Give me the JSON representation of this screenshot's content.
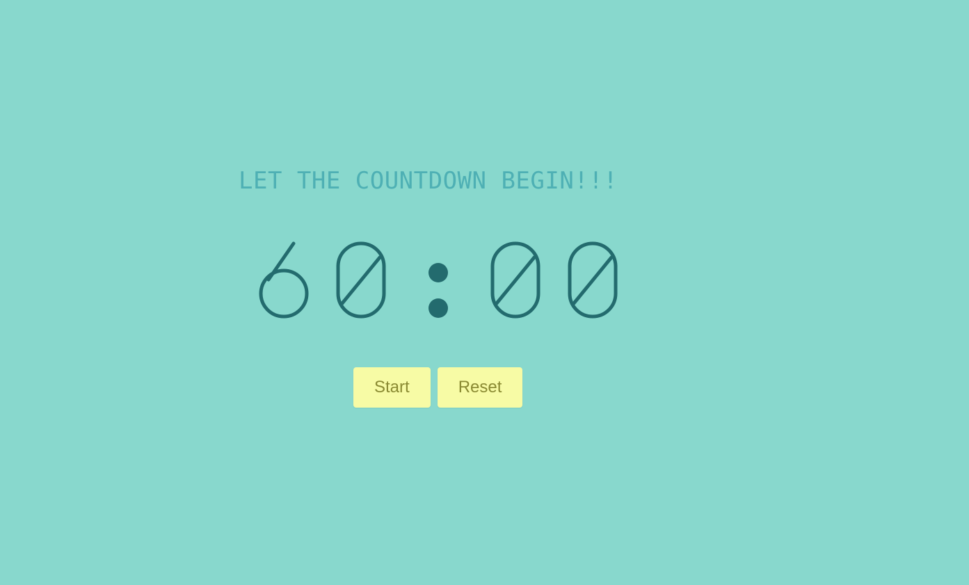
{
  "heading": "LET THE COUNTDOWN BEGIN!!!",
  "timer": {
    "display": "60:00",
    "minutes": "60",
    "seconds": "00"
  },
  "buttons": {
    "start_label": "Start",
    "reset_label": "Reset"
  },
  "colors": {
    "background": "#88d8cd",
    "heading": "#4eb0b4",
    "digits": "#236b6e",
    "button_bg": "#f7fba5",
    "button_text": "#8a8a32"
  }
}
